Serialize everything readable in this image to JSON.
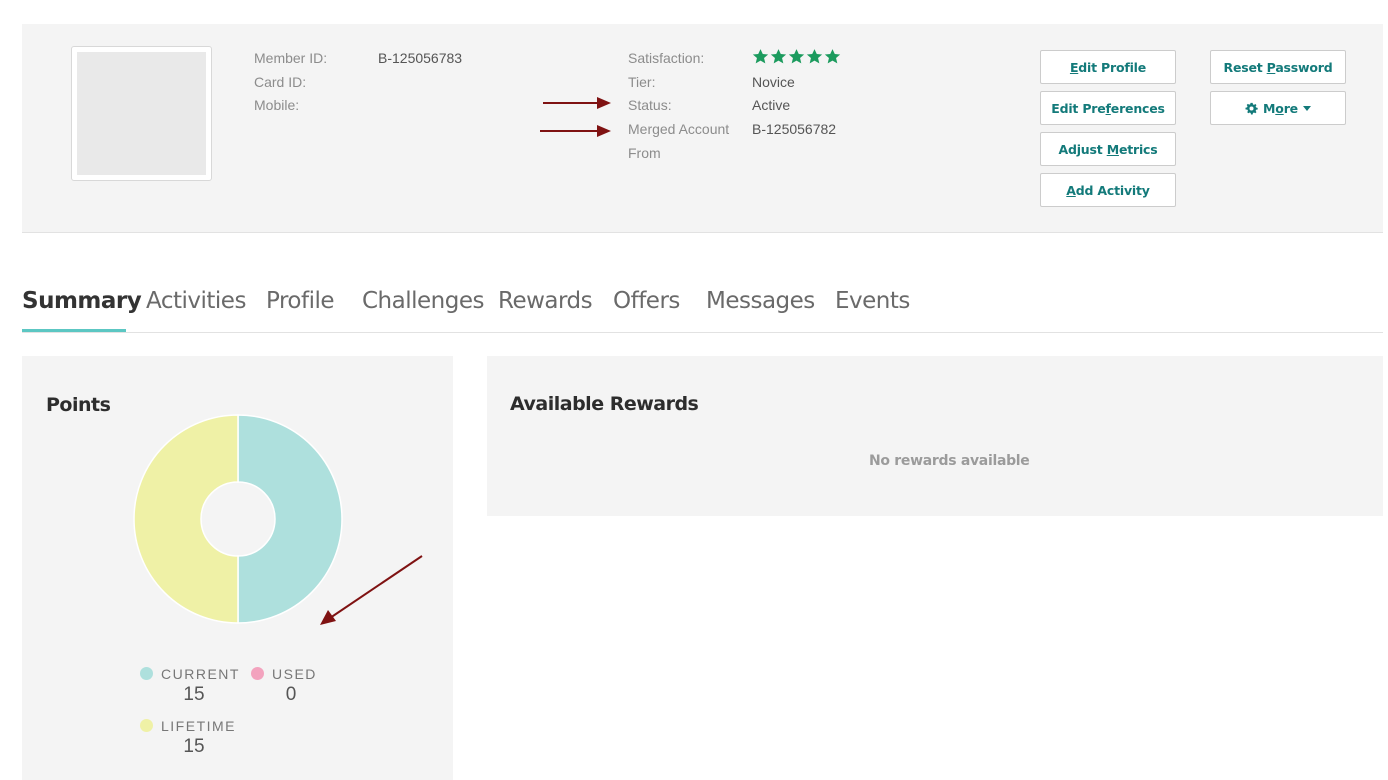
{
  "member": {
    "labels": {
      "member_id": "Member ID:",
      "card_id": "Card ID:",
      "mobile": "Mobile:",
      "satisfaction": "Satisfaction:",
      "tier": "Tier:",
      "status": "Status:",
      "merged_line1": "Merged Account",
      "merged_line2": "From"
    },
    "member_id": "B-125056783",
    "card_id": "",
    "mobile": "",
    "satisfaction_stars": 5,
    "tier": "Novice",
    "status": "Active",
    "merged_from": "B-125056782"
  },
  "actions": {
    "edit_profile": {
      "label": "Edit Profile",
      "accesskey": "E"
    },
    "edit_preferences": {
      "label": "Edit Preferences",
      "accesskey": "f"
    },
    "adjust_metrics": {
      "label": "Adjust Metrics",
      "accesskey": "M"
    },
    "add_activity": {
      "label": "Add Activity",
      "accesskey": "A"
    },
    "reset_password": {
      "label": "Reset Password",
      "accesskey": "P"
    },
    "more": {
      "label": "More",
      "accesskey": "o",
      "icon": "gear-icon"
    }
  },
  "tabs": [
    "Summary",
    "Activities",
    "Profile",
    "Challenges",
    "Rewards",
    "Offers",
    "Messages",
    "Events"
  ],
  "active_tab": "Summary",
  "points": {
    "title": "Points",
    "chart_data": {
      "type": "pie",
      "labels": [
        "CURRENT",
        "USED",
        "LIFETIME"
      ],
      "values": [
        15,
        0,
        15
      ],
      "colors": [
        "#aee0dd",
        "#f3a3be",
        "#eff1a6"
      ]
    },
    "legend": [
      {
        "label": "CURRENT",
        "value": "15",
        "color": "#aee0dd"
      },
      {
        "label": "USED",
        "value": "0",
        "color": "#f3a3be"
      },
      {
        "label": "LIFETIME",
        "value": "15",
        "color": "#eff1a6"
      }
    ]
  },
  "rewards": {
    "title": "Available Rewards",
    "empty_message": "No rewards available"
  },
  "colors": {
    "accent": "#137a7a",
    "tab_underline": "#5cc7c3",
    "star": "#1c9b5e",
    "arrow": "#7f1212"
  }
}
